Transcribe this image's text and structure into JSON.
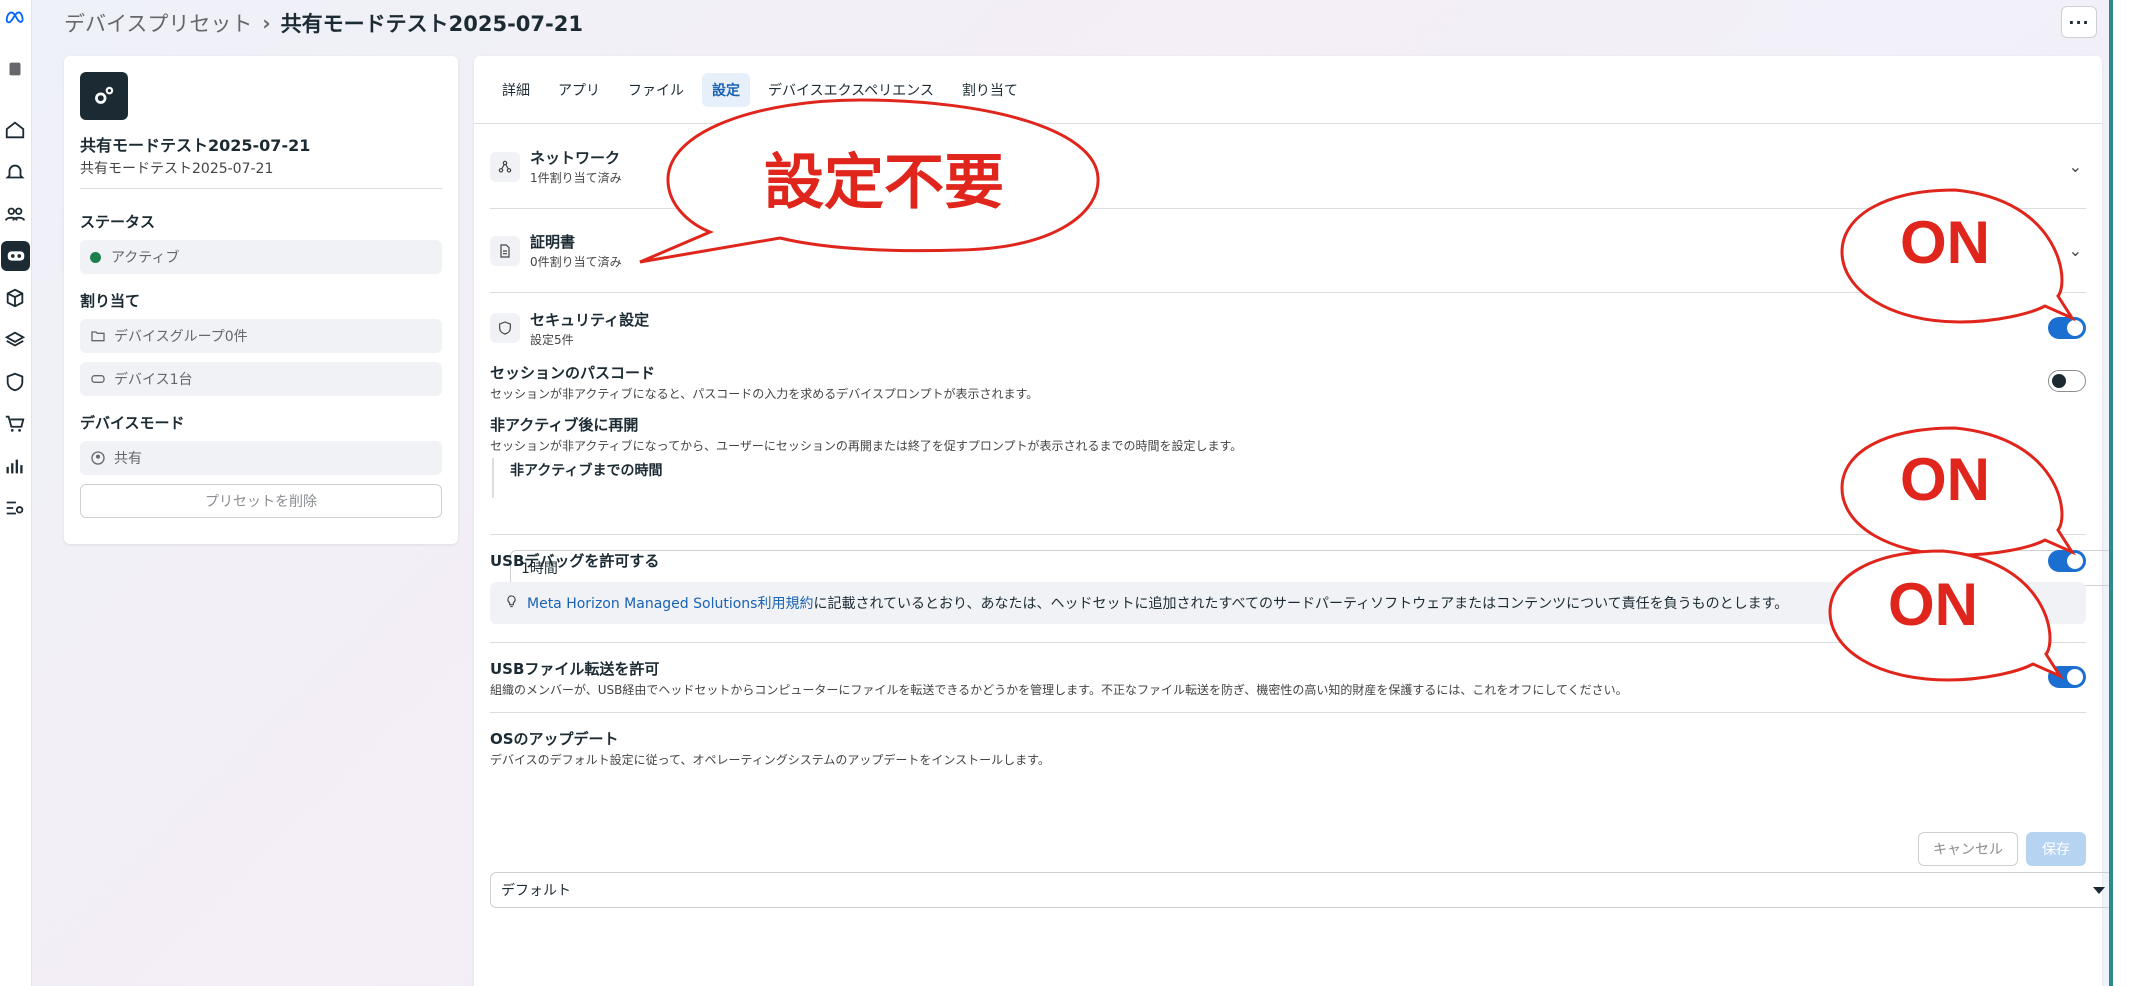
{
  "breadcrumb": {
    "parent": "デバイスプリセット",
    "current": "共有モードテスト2025-07-21"
  },
  "header": {
    "more_label": "···"
  },
  "left_panel": {
    "preset_name": "共有モードテスト2025-07-21",
    "preset_subtitle": "共有モードテスト2025-07-21",
    "status_title": "ステータス",
    "status_value": "アクティブ",
    "status_color": "#1e7f4e",
    "assign_title": "割り当て",
    "device_groups": "デバイスグループ0件",
    "devices": "デバイス1台",
    "mode_title": "デバイスモード",
    "mode_value": "共有",
    "delete_label": "プリセットを削除"
  },
  "tabs": [
    {
      "label": "詳細"
    },
    {
      "label": "アプリ"
    },
    {
      "label": "ファイル"
    },
    {
      "label": "設定",
      "active": true
    },
    {
      "label": "デバイスエクスペリエンス"
    },
    {
      "label": "割り当て"
    }
  ],
  "sections": {
    "network": {
      "title": "ネットワーク",
      "sub": "1件割り当て済み"
    },
    "certificate": {
      "title": "証明書",
      "sub": "0件割り当て済み"
    },
    "security": {
      "title": "セキュリティ設定",
      "sub": "設定5件",
      "enabled": true
    }
  },
  "settings": {
    "passcode": {
      "title": "セッションのパスコード",
      "desc": "セッションが非アクティブになると、パスコードの入力を求めるデバイスプロンプトが表示されます。",
      "enabled": false
    },
    "resume": {
      "title": "非アクティブ後に再開",
      "desc": "セッションが非アクティブになってから、ユーザーにセッションの再開または終了を促すプロンプトが表示されるまでの時間を設定します。"
    },
    "inactive_time": {
      "label": "非アクティブまでの時間",
      "value": "1時間"
    },
    "usb_debug": {
      "title": "USBデバッグを許可する",
      "enabled": true,
      "info_link": "Meta Horizon Managed Solutions利用規約",
      "info_text": "に記載されているとおり、あなたは、ヘッドセットに追加されたすべてのサードパーティソフトウェアまたはコンテンツについて責任を負うものとします。"
    },
    "usb_transfer": {
      "title": "USBファイル転送を許可",
      "desc": "組織のメンバーが、USB経由でヘッドセットからコンピューターにファイルを転送できるかどうかを管理します。不正なファイル転送を防ぎ、機密性の高い知的財産を保護するには、これをオフにしてください。",
      "enabled": true
    },
    "os_update": {
      "title": "OSのアップデート",
      "desc": "デバイスのデフォルト設定に従って、オペレーティングシステムのアップデートをインストールします。",
      "value": "デフォルト"
    }
  },
  "actions": {
    "cancel": "キャンセル",
    "save": "保存"
  },
  "annotations": {
    "not_needed": "設定不要",
    "on1": "ON",
    "on2": "ON",
    "on3": "ON",
    "color": "#e0261c"
  }
}
